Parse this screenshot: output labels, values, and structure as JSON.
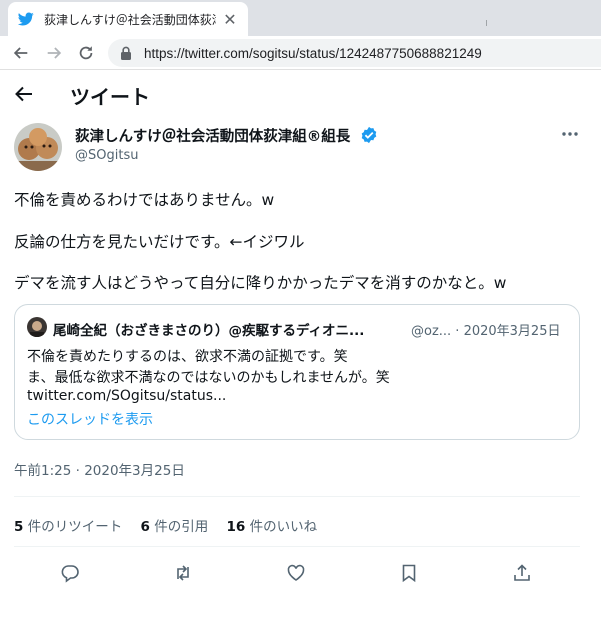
{
  "browser": {
    "tab_title": "荻津しんすけ＠社会活動団体荻津組",
    "tab_close": "✕",
    "url": "https://twitter.com/sogitsu/status/1242487750688821249"
  },
  "header": {
    "title": "ツイート"
  },
  "author": {
    "display_name": "荻津しんすけ＠社会活動団体荻津組®組長",
    "handle": "@SOgitsu"
  },
  "tweet": {
    "lines": [
      "不倫を責めるわけではありません。w",
      "反論の仕方を見たいだけです。←イジワル",
      "デマを流す人はどうやって自分に降りかかったデマを消すのかなと。w"
    ],
    "timestamp": "午前1:25 · 2020年3月25日"
  },
  "quote": {
    "name": "尾崎全紀（おざきまさのり）@疾駆するディオニ...",
    "meta": "@oz... · 2020年3月25日",
    "lines": [
      "不倫を責めたりするのは、欲求不満の証拠です。笑",
      "ま、最低な欲求不満なのではないのかもしれませんが。笑",
      "twitter.com/SOgitsu/status..."
    ],
    "show_thread": "このスレッドを表示"
  },
  "stats": {
    "retweets_count": "5",
    "retweets_label": " 件のリツイート",
    "quotes_count": "6",
    "quotes_label": " 件の引用",
    "likes_count": "16",
    "likes_label": " 件のいいね"
  },
  "icons": [
    "twitter-bird-icon",
    "close-icon",
    "back-icon",
    "forward-icon",
    "reload-icon",
    "lock-icon",
    "back-arrow-icon",
    "verified-icon",
    "more-icon",
    "reply-icon",
    "retweet-icon",
    "like-icon",
    "bookmark-icon",
    "share-icon"
  ],
  "colors": {
    "accent": "#1d9bf0",
    "text": "#0f1419",
    "secondary": "#536471",
    "border": "#cfd9de"
  }
}
